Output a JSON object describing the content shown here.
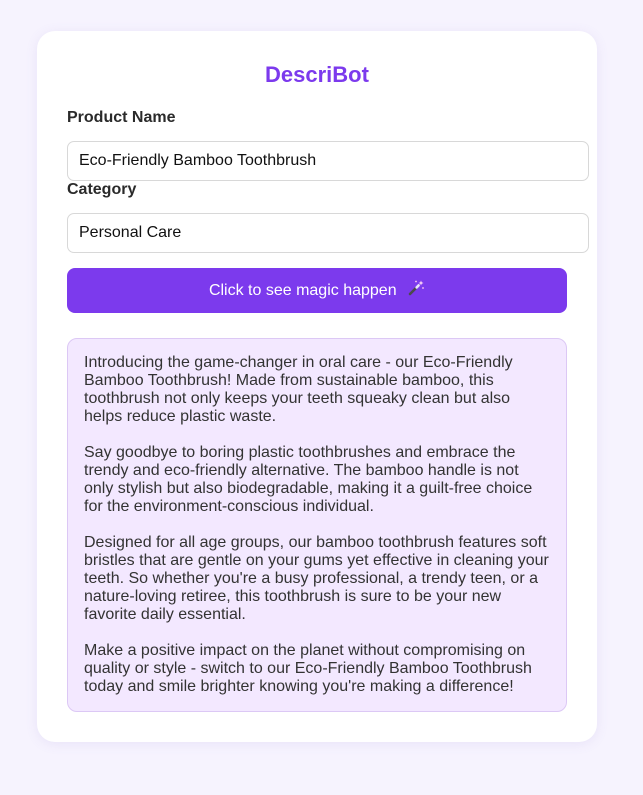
{
  "app": {
    "title": "DescriBot"
  },
  "form": {
    "product_name": {
      "label": "Product Name",
      "value": "Eco-Friendly Bamboo Toothbrush"
    },
    "category": {
      "label": "Category",
      "value": "Personal Care"
    },
    "generate_button_label": "Click to see magic happen"
  },
  "output": {
    "paragraphs": [
      "Introducing the game-changer in oral care - our Eco-Friendly Bamboo Toothbrush! Made from sustainable bamboo, this toothbrush not only keeps your teeth squeaky clean but also helps reduce plastic waste.",
      "Say goodbye to boring plastic toothbrushes and embrace the trendy and eco-friendly alternative. The bamboo handle is not only stylish but also biodegradable, making it a guilt-free choice for the environment-conscious individual.",
      "Designed for all age groups, our bamboo toothbrush features soft bristles that are gentle on your gums yet effective in cleaning your teeth. So whether you're a busy professional, a trendy teen, or a nature-loving retiree, this toothbrush is sure to be your new favorite daily essential.",
      "Make a positive impact on the planet without compromising on quality or style - switch to our Eco-Friendly Bamboo Toothbrush today and smile brighter knowing you're making a difference!"
    ]
  },
  "icons": {
    "button_icon": "magic-wand-icon"
  },
  "colors": {
    "accent": "#7c3aed",
    "page_background": "#f6f3fe",
    "output_background": "#f3e8ff"
  }
}
